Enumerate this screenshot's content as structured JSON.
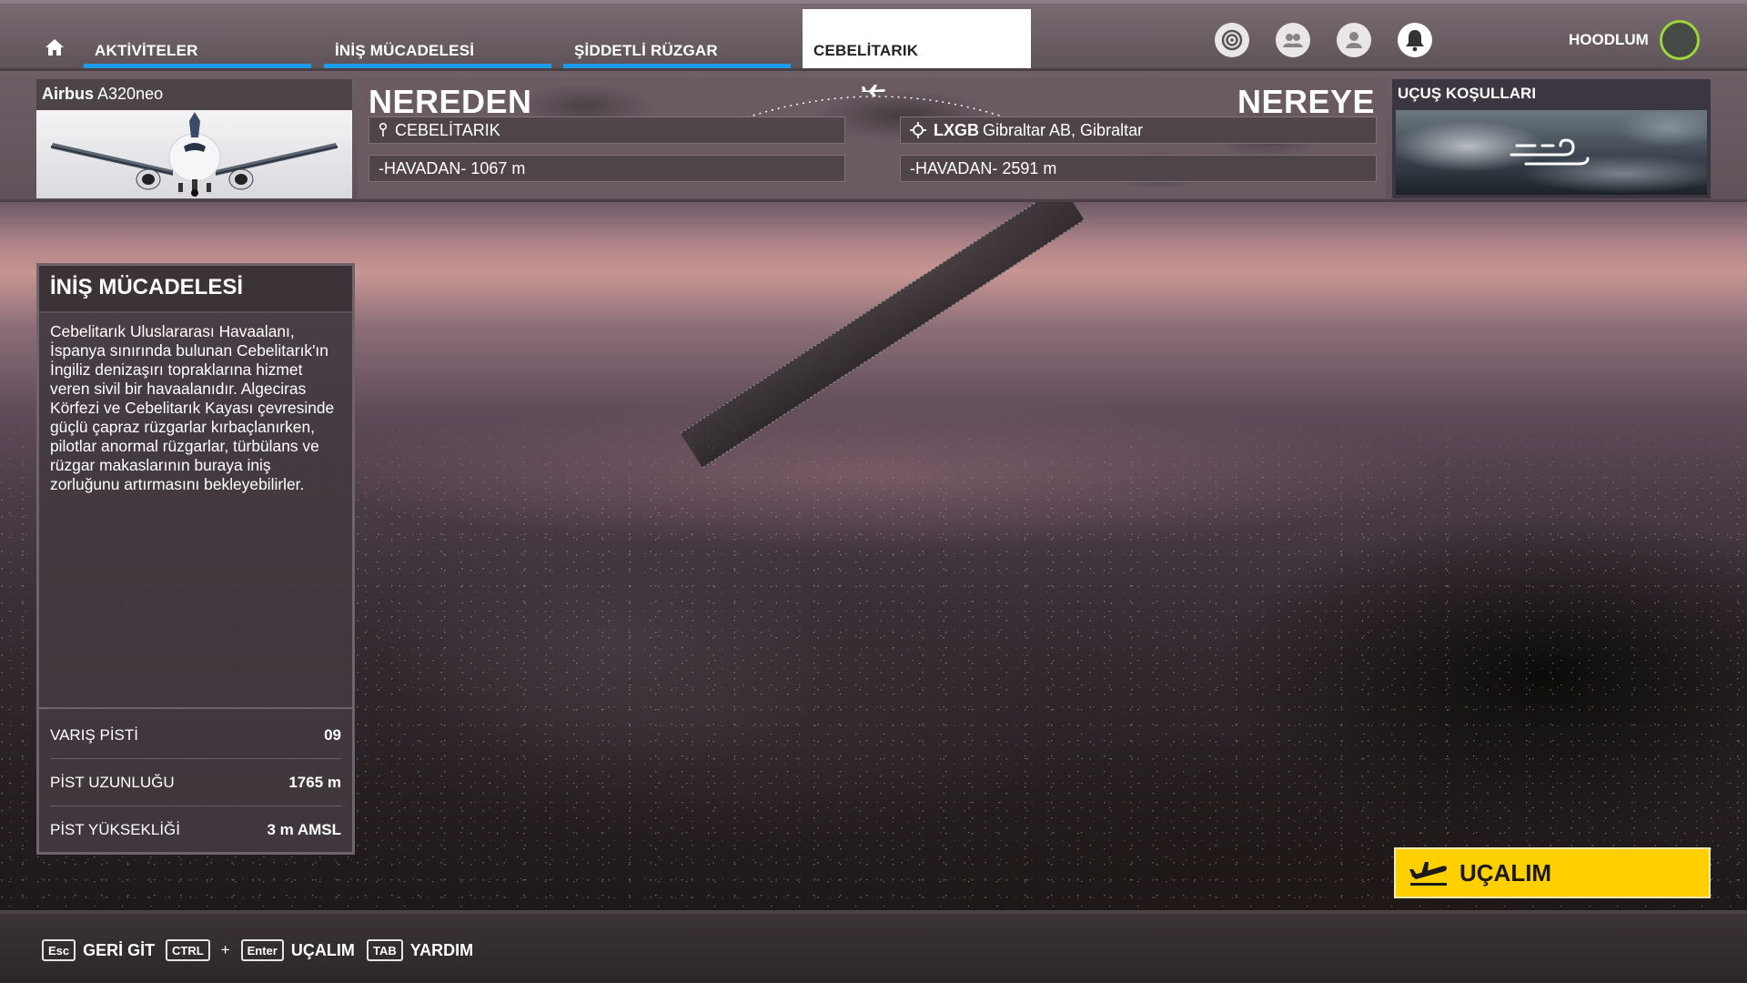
{
  "nav": {
    "tabs": [
      {
        "label": "AKTİVİTELER"
      },
      {
        "label": "İNİŞ MÜCADELESİ"
      },
      {
        "label": "ŞİDDETLİ RÜZGAR"
      },
      {
        "label": "CEBELİTARIK"
      }
    ],
    "username": "HOODLUM",
    "icons": [
      "home-icon",
      "target-icon",
      "friends-icon",
      "profile-icon",
      "bell-icon"
    ]
  },
  "aircraft": {
    "brand": "Airbus",
    "model": "A320neo"
  },
  "route": {
    "from_label": "NEREDEN",
    "to_label": "NEREYE",
    "from_location": "CEBELİTARIK",
    "from_altitude": "-HAVADAN- 1067 m",
    "to_code": "LXGB",
    "to_name": "Gibraltar AB, Gibraltar",
    "to_altitude": "-HAVADAN- 2591 m"
  },
  "conditions": {
    "label": "UÇUŞ KOŞULLARI"
  },
  "challenge": {
    "title": "İNİŞ MÜCADELESİ",
    "description": "Cebelitarık Uluslararası Havaalanı, İspanya sınırında bulunan Cebelitarık'ın İngiliz denizaşırı topraklarına hizmet veren sivil bir havaalanıdır. Algeciras Körfezi ve Cebelitarık Kayası çevresinde güçlü çapraz rüzgarlar kırbaçlanırken, pilotlar anormal rüzgarlar, türbülans ve rüzgar makaslarının buraya iniş zorluğunu artırmasını bekleyebilirler.",
    "stats": [
      {
        "label": "VARIŞ PİSTİ",
        "value": "09"
      },
      {
        "label": "PİST UZUNLUĞU",
        "value": "1765 m"
      },
      {
        "label": "PİST YÜKSEKLİĞİ",
        "value": "3 m AMSL"
      }
    ]
  },
  "fly_button": {
    "label": "UÇALIM"
  },
  "bottom_hints": {
    "back_key": "Esc",
    "back_label": "GERİ GİT",
    "fly_key1": "CTRL",
    "fly_plus": "+",
    "fly_key2": "Enter",
    "fly_label": "UÇALIM",
    "help_key": "TAB",
    "help_label": "YARDIM"
  },
  "colors": {
    "accent_blue": "#1e9be8",
    "fly_yellow": "#ffd000",
    "avatar_ring": "#9ad63a"
  }
}
